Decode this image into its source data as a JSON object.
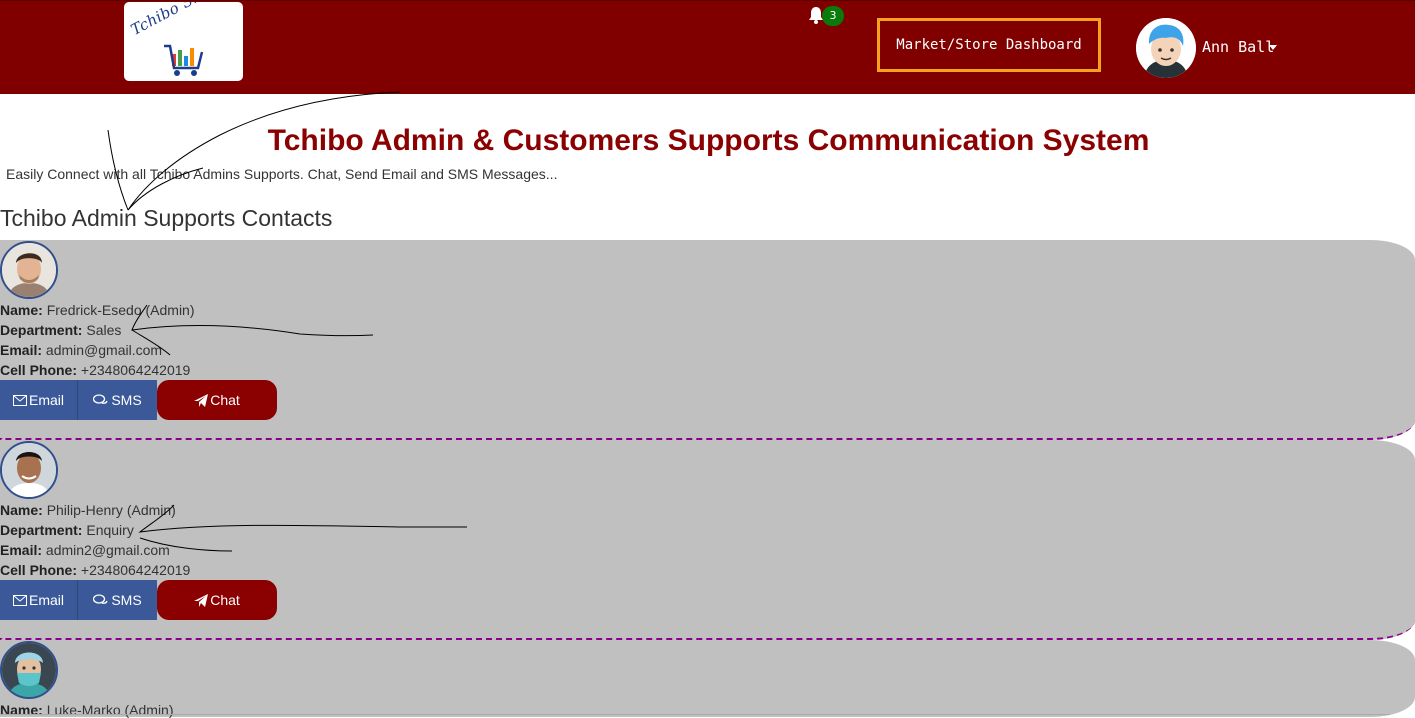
{
  "header": {
    "logo_text": "Tchibo Shopee",
    "notifications_count": "3",
    "dashboard_button": "Market/Store Dashboard",
    "user_name": "Ann Ball"
  },
  "main": {
    "title": "Tchibo Admin & Customers Supports Communication System",
    "subtitle": "Easily Connect with all Tchibo Admins Supports. Chat, Send Email and SMS Messages...",
    "section_title": "Tchibo Admin Supports Contacts"
  },
  "labels": {
    "name": "Name:",
    "department": "Department:",
    "email": "Email:",
    "cell_phone": "Cell Phone:"
  },
  "contacts": [
    {
      "name": "Fredrick-Esedo (Admin)",
      "department": "Sales",
      "email": "admin@gmail.com",
      "cell_phone": "+2348064242019",
      "email_button": "Email",
      "sms_button": "SMS",
      "chat_button": "Chat"
    },
    {
      "name": "Philip-Henry (Admin)",
      "department": "Enquiry",
      "email": "admin2@gmail.com",
      "cell_phone": "+2348064242019",
      "email_button": "Email",
      "sms_button": "SMS",
      "chat_button": "Chat"
    },
    {
      "name": "Luke-Marko (Admin)"
    }
  ],
  "colors": {
    "header": "#800000",
    "title": "#8b0000",
    "card": "#c0c0c0",
    "primary_button": "#3b5998",
    "chat_button": "#8b0000",
    "dashboard_border": "#f6a21a",
    "badge": "#0a7a0a",
    "separator": "#8b008b"
  }
}
